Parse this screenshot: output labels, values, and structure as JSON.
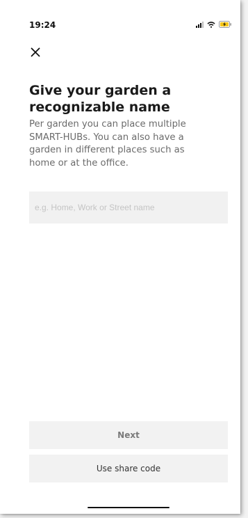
{
  "status_bar": {
    "time": "19:24",
    "icons": [
      "signal-icon",
      "wifi-icon",
      "battery-charging-icon"
    ],
    "battery_color": "#f5c518"
  },
  "header": {
    "close_icon": "close-icon"
  },
  "main": {
    "title": "Give your garden a recognizable name",
    "description": "Per garden you can place multiple SMART-HUBs. You can also have a garden in different places such as home or at the office.",
    "name_input": {
      "value": "",
      "placeholder": "e.g. Home, Work or Street name"
    }
  },
  "footer": {
    "next_label": "Next",
    "share_code_label": "Use share code"
  }
}
